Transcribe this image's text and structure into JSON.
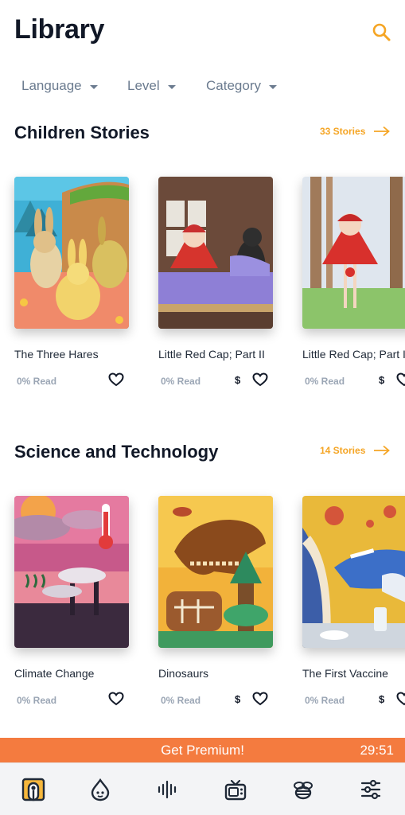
{
  "header": {
    "title": "Library"
  },
  "filters": [
    {
      "label": "Language"
    },
    {
      "label": "Level"
    },
    {
      "label": "Category"
    }
  ],
  "sections": [
    {
      "title": "Children Stories",
      "see_all": "33 Stories",
      "books": [
        {
          "title": "The Three Hares",
          "progress": "0% Read",
          "price": ""
        },
        {
          "title": "Little Red Cap; Part II",
          "progress": "0% Read",
          "price": "$"
        },
        {
          "title": "Little Red Cap; Part I",
          "progress": "0% Read",
          "price": "$"
        }
      ]
    },
    {
      "title": "Science and Technology",
      "see_all": "14 Stories",
      "books": [
        {
          "title": "Climate Change",
          "progress": "0% Read",
          "price": ""
        },
        {
          "title": "Dinosaurs",
          "progress": "0% Read",
          "price": "$"
        },
        {
          "title": "The First Vaccine",
          "progress": "0% Read",
          "price": "$"
        }
      ]
    }
  ],
  "premium": {
    "label": "Get Premium!",
    "timer": "29:51"
  },
  "nav": [
    {
      "icon": "library-icon",
      "active": true
    },
    {
      "icon": "drop-icon",
      "active": false
    },
    {
      "icon": "audio-wave-icon",
      "active": false
    },
    {
      "icon": "tv-icon",
      "active": false
    },
    {
      "icon": "bee-icon",
      "active": false
    },
    {
      "icon": "settings-sliders-icon",
      "active": false
    }
  ],
  "colors": {
    "accent": "#f5a524",
    "premium": "#f47b3f",
    "muted": "#6b7b8f"
  }
}
